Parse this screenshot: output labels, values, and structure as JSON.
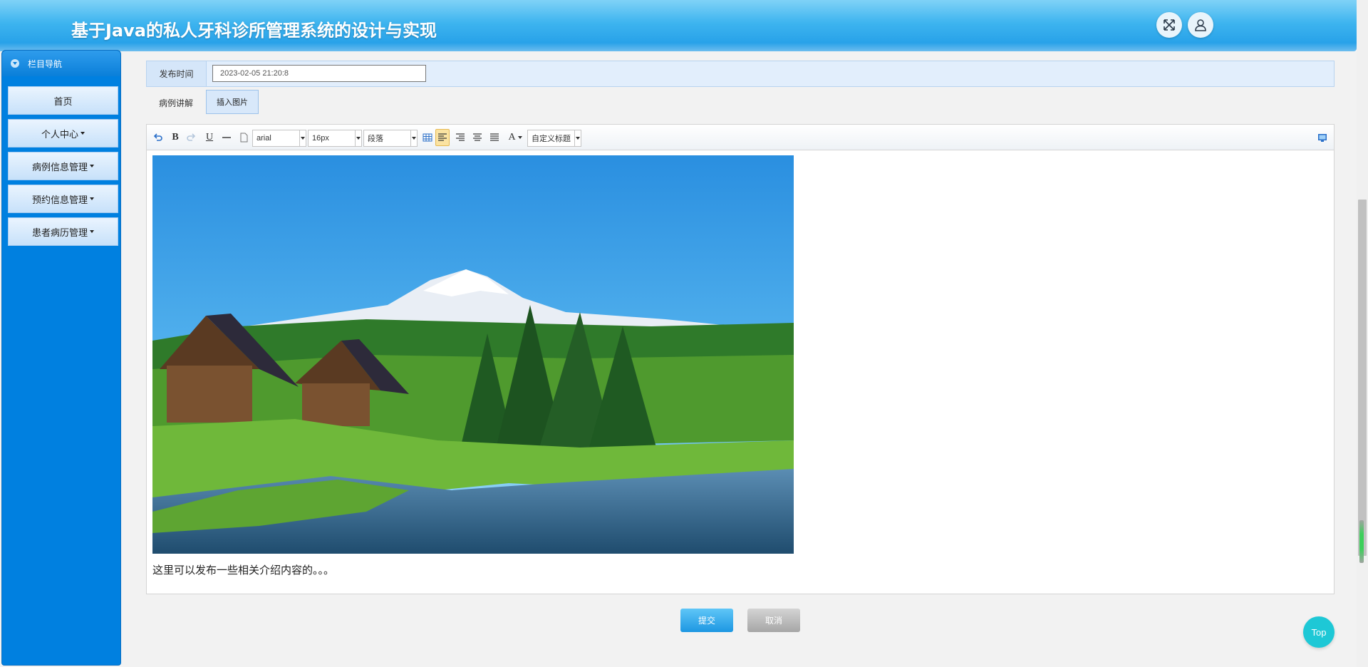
{
  "header": {
    "title": "基于Java的私人牙科诊所管理系统的设计与实现"
  },
  "sidebar": {
    "heading": "栏目导航",
    "items": [
      {
        "label": "首页",
        "has_caret": false
      },
      {
        "label": "个人中心",
        "has_caret": true
      },
      {
        "label": "病例信息管理",
        "has_caret": true
      },
      {
        "label": "预约信息管理",
        "has_caret": true
      },
      {
        "label": "患者病历管理",
        "has_caret": true
      }
    ]
  },
  "form": {
    "publish_time_label": "发布时间",
    "publish_time_value": "2023-02-05 21:20:8",
    "case_explain_label": "病例讲解",
    "insert_image_label": "插入图片"
  },
  "editor": {
    "toolbar": {
      "bold": "B",
      "underline": "U",
      "font_family": "arial",
      "font_size": "16px",
      "paragraph": "段落",
      "font_color": "A",
      "custom_heading": "自定义标题"
    },
    "content_text": "这里可以发布一些相关介绍内容的。。。"
  },
  "actions": {
    "submit": "提交",
    "cancel": "取消",
    "top": "Top"
  },
  "colors": {
    "header": "#1f9ae6",
    "sidebar": "#0080e0",
    "submit": "#1d97e2",
    "top": "#1ec8d6"
  }
}
